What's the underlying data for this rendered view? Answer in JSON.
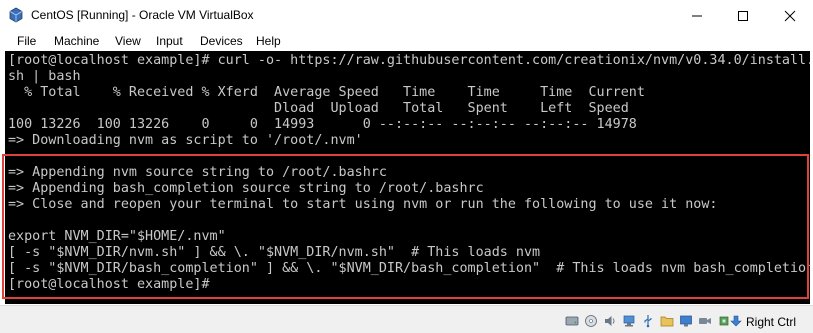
{
  "window": {
    "title": "CentOS [Running] - Oracle VM VirtualBox"
  },
  "menu": {
    "items": [
      "File",
      "Machine",
      "View",
      "Input",
      "Devices",
      "Help"
    ]
  },
  "terminal": {
    "lines": [
      "[root@localhost example]# curl -o- https://raw.githubusercontent.com/creationix/nvm/v0.34.0/install.",
      "sh | bash",
      "  % Total    % Received % Xferd  Average Speed   Time    Time     Time  Current",
      "                                 Dload  Upload   Total   Spent    Left  Speed",
      "100 13226  100 13226    0     0  14993      0 --:--:-- --:--:-- --:--:-- 14978",
      "=> Downloading nvm as script to '/root/.nvm'",
      "",
      "=> Appending nvm source string to /root/.bashrc",
      "=> Appending bash_completion source string to /root/.bashrc",
      "=> Close and reopen your terminal to start using nvm or run the following to use it now:",
      "",
      "export NVM_DIR=\"$HOME/.nvm\"",
      "[ -s \"$NVM_DIR/nvm.sh\" ] && \\. \"$NVM_DIR/nvm.sh\"  # This loads nvm",
      "[ -s \"$NVM_DIR/bash_completion\" ] && \\. \"$NVM_DIR/bash_completion\"  # This loads nvm bash_completion",
      "[root@localhost example]#"
    ]
  },
  "statusbar": {
    "host_key": "Right Ctrl",
    "icons": [
      "hard-disk-icon",
      "optical-disc-icon",
      "audio-icon",
      "network-icon",
      "usb-icon",
      "shared-folder-icon",
      "display-icon",
      "video-capture-icon",
      "recording-icon",
      "cpu-icon",
      "mouse-integration-icon",
      "keyboard-icon"
    ]
  },
  "colors": {
    "terminal_bg": "#000000",
    "terminal_fg": "#c8c8c8",
    "highlight_border": "#e0413a"
  }
}
